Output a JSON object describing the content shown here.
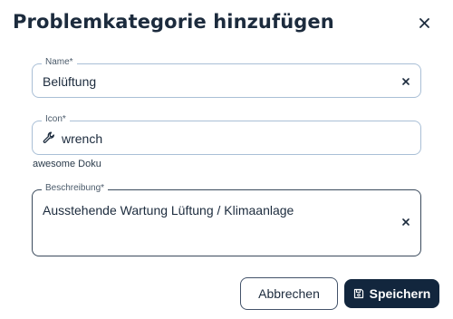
{
  "dialog": {
    "title": "Problemkategorie hinzufügen"
  },
  "fields": {
    "name": {
      "label": "Name*",
      "value": "Belüftung"
    },
    "icon": {
      "label": "Icon*",
      "value": "wrench",
      "icon": "wrench-icon"
    },
    "description": {
      "label": "Beschreibung*",
      "value": "Ausstehende Wartung Lüftung / Klimaanlage"
    }
  },
  "helper": {
    "text": "awesome Doku"
  },
  "buttons": {
    "cancel": "Abbrechen",
    "save": "Speichern"
  },
  "colors": {
    "primary": "#12263d",
    "field_border": "#a9bfd6",
    "text": "#1c2b3d"
  }
}
